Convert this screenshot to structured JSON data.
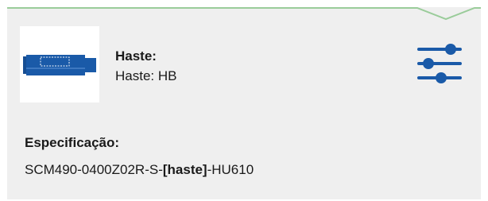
{
  "haste": {
    "title": "Haste:",
    "value": "Haste: HB"
  },
  "specification": {
    "title": "Especificação:",
    "prefix": "SCM490-0400Z02R-S-",
    "highlight": "[haste]",
    "suffix": "-HU610"
  },
  "icons": {
    "product": "sensor-rod-icon",
    "filter": "sliders-icon"
  },
  "colors": {
    "accent_green": "#9acc9a",
    "brand_blue": "#1a5aa8",
    "panel_bg": "#efefef"
  }
}
